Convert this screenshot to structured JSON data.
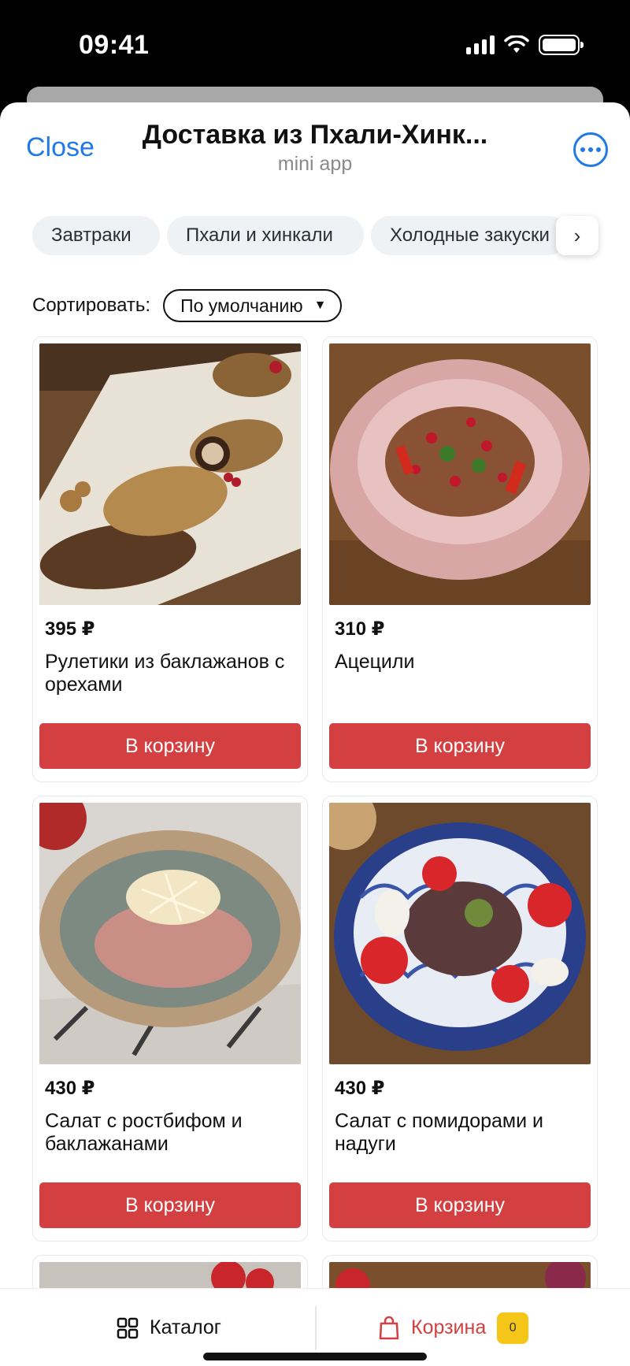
{
  "status": {
    "time": "09:41"
  },
  "header": {
    "close_label": "Close",
    "title": "Доставка из Пхали-Хинк...",
    "subtitle": "mini app"
  },
  "categories": [
    {
      "label": "Завтраки"
    },
    {
      "label": "Пхали и хинкали"
    },
    {
      "label": "Холодные закуски"
    }
  ],
  "sort": {
    "label": "Сортировать:",
    "value": "По умолчанию"
  },
  "products": [
    {
      "price": "395 ₽",
      "name": "Рулетики из баклажанов с орехами",
      "button": "В корзину"
    },
    {
      "price": "310 ₽",
      "name": "Ацецили",
      "button": "В корзину"
    },
    {
      "price": "430 ₽",
      "name": "Салат с ростбифом и баклажанами",
      "button": "В корзину"
    },
    {
      "price": "430 ₽",
      "name": "Салат с помидорами и надуги",
      "button": "В корзину"
    }
  ],
  "tabbar": {
    "catalog_label": "Каталог",
    "cart_label": "Корзина",
    "cart_count": "0"
  },
  "colors": {
    "accent_blue": "#1f7ae8",
    "button_red": "#d44042",
    "badge_yellow": "#f5c518"
  }
}
